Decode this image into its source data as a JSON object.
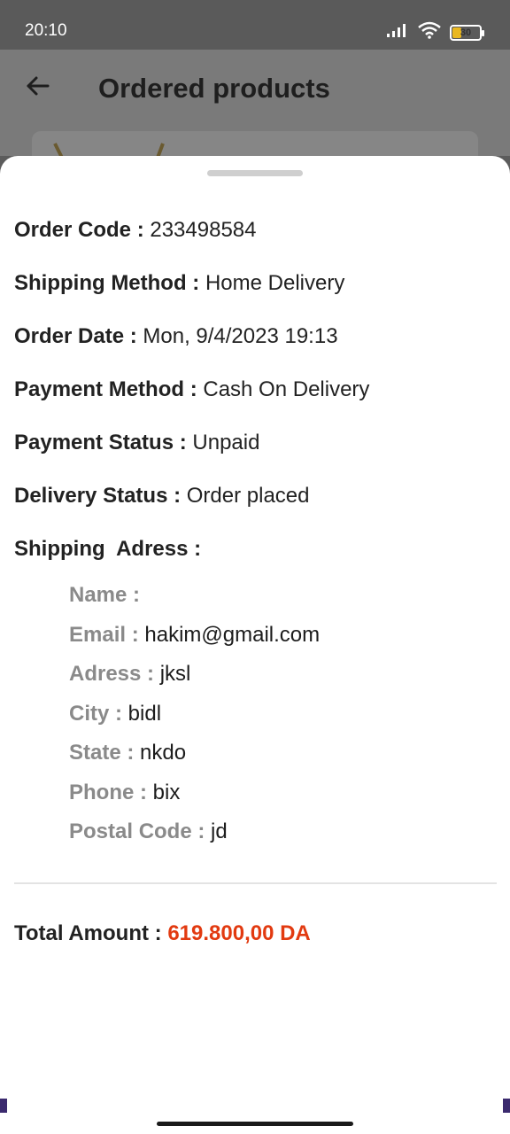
{
  "status_bar": {
    "time": "20:10",
    "battery_level": "30",
    "battery_fraction": 0.3,
    "icons": [
      "signal-icon",
      "wifi-icon",
      "battery-icon"
    ]
  },
  "app_bar": {
    "title": "Ordered products",
    "back_icon": "arrow-left-icon"
  },
  "order": {
    "code_label": "Order Code :",
    "code": "233498584",
    "shipping_method_label": "Shipping Method :",
    "shipping_method": "Home Delivery",
    "order_date_label": "Order Date :",
    "order_date": "Mon, 9/4/2023 19:13",
    "payment_method_label": "Payment Method :",
    "payment_method": "Cash On Delivery",
    "payment_status_label": "Payment Status :",
    "payment_status": "Unpaid",
    "delivery_status_label": "Delivery Status :",
    "delivery_status": "Order placed"
  },
  "shipping_address": {
    "heading": "Shipping  Adress :",
    "name_label": "Name :",
    "name": "",
    "email_label": "Email :",
    "email": "hakim@gmail.com",
    "adress_label": "Adress :",
    "adress": "jksl",
    "city_label": "City :",
    "city": "bidl",
    "state_label": "State :",
    "state": "nkdo",
    "phone_label": "Phone :",
    "phone": "bix",
    "postal_label": "Postal Code :",
    "postal": "jd"
  },
  "total": {
    "label": "Total Amount :",
    "value": "619.800,00 DA"
  },
  "colors": {
    "total_accent": "#e23a10",
    "battery": "#e9b71f",
    "scrim": "#5c5c5c"
  }
}
